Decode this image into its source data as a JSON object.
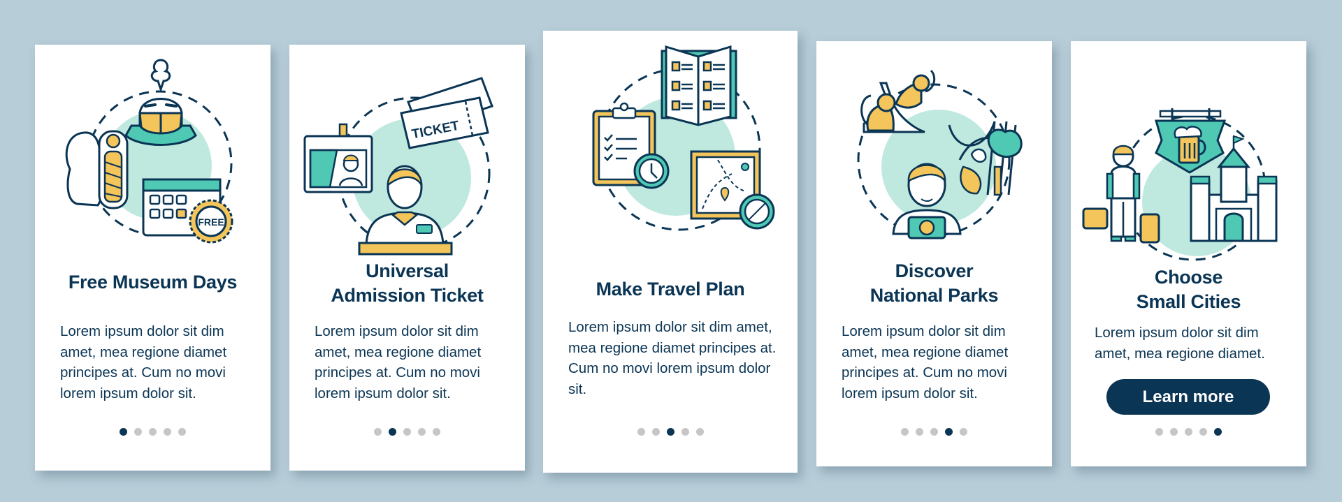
{
  "colors": {
    "background": "#b7cdd8",
    "navy": "#0b3554",
    "teal": "#4fc9b4",
    "mint": "#bfe9df",
    "yellow": "#f4c55a",
    "dot_inactive": "#c6c6c6"
  },
  "total_pages": 5,
  "cards": [
    {
      "illustration": "free-museum-days-illustration",
      "title": "Free Museum Days",
      "body": "Lorem ipsum dolor sit dim amet, mea regione diamet principes at. Cum no movi lorem ipsum dolor sit.",
      "badge_text": "FREE",
      "active_page": 1
    },
    {
      "illustration": "admission-ticket-illustration",
      "title_lines": [
        "Universal",
        "Admission Ticket"
      ],
      "body": "Lorem ipsum dolor sit dim amet, mea regione diamet principes at. Cum no movi lorem ipsum dolor sit.",
      "ticket_text": "TICKET",
      "active_page": 2
    },
    {
      "illustration": "travel-plan-illustration",
      "title": "Make Travel Plan",
      "body": "Lorem ipsum dolor sit dim amet, mea regione diamet principes at. Cum no movi lorem ipsum dolor sit.",
      "active_page": 3
    },
    {
      "illustration": "national-parks-illustration",
      "title_lines": [
        "Discover",
        "National Parks"
      ],
      "body": "Lorem ipsum dolor sit dim amet, mea regione diamet principes at. Cum no movi lorem ipsum dolor sit.",
      "active_page": 4
    },
    {
      "illustration": "small-cities-illustration",
      "title_lines": [
        "Choose",
        "Small Cities"
      ],
      "body": "Lorem ipsum dolor sit dim amet, mea regione diamet.",
      "button_label": "Learn more",
      "active_page": 5
    }
  ]
}
